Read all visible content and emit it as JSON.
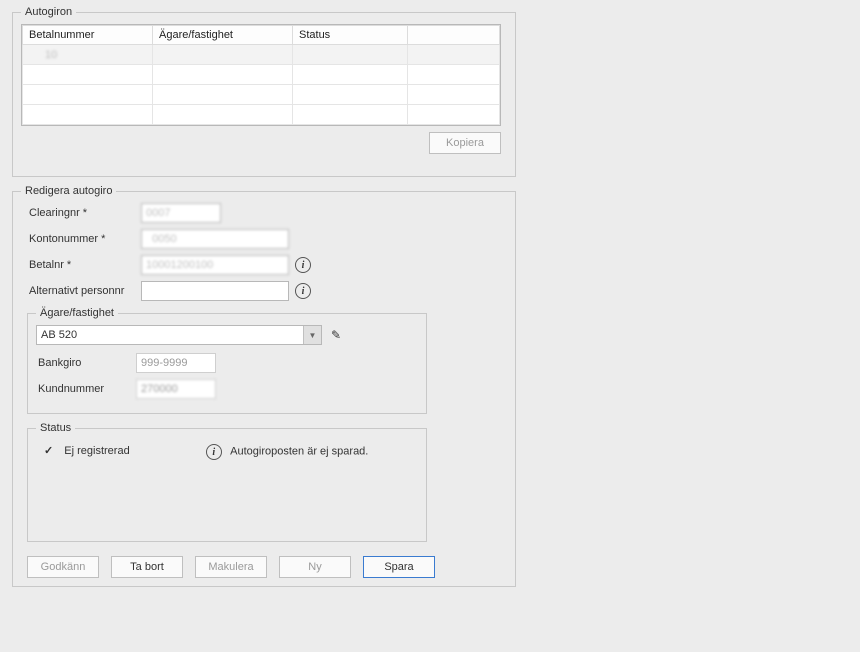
{
  "autogiron": {
    "legend": "Autogiron",
    "columns": [
      "Betalnummer",
      "Ägare/fastighet",
      "Status",
      ""
    ],
    "rows": [
      {
        "betalnr": "10           ",
        "agare": "",
        "status": ""
      },
      {
        "betalnr": "",
        "agare": "",
        "status": ""
      },
      {
        "betalnr": "",
        "agare": "",
        "status": ""
      },
      {
        "betalnr": "",
        "agare": "",
        "status": ""
      }
    ],
    "copy_label": "Kopiera"
  },
  "edit": {
    "legend": "Redigera autogiro",
    "clearing_label": "Clearingnr *",
    "clearing_value": "0007",
    "konto_label": "Kontonummer *",
    "konto_value": "  0050",
    "betal_label": "Betalnr *",
    "betal_value": "10001200100",
    "altpers_label": "Alternativt personnr",
    "altpers_value": ""
  },
  "owner": {
    "legend": "Ägare/fastighet",
    "combo_value": "AB 520",
    "bankgiro_label": "Bankgiro",
    "bankgiro_value": "999-9999",
    "kundnr_label": "Kundnummer",
    "kundnr_value": "270000"
  },
  "status": {
    "legend": "Status",
    "state_text": "Ej registrerad",
    "msg": "Autogiroposten är ej sparad."
  },
  "buttons": {
    "godkann": "Godkänn",
    "tabort": "Ta bort",
    "makulera": "Makulera",
    "ny": "Ny",
    "spara": "Spara"
  }
}
